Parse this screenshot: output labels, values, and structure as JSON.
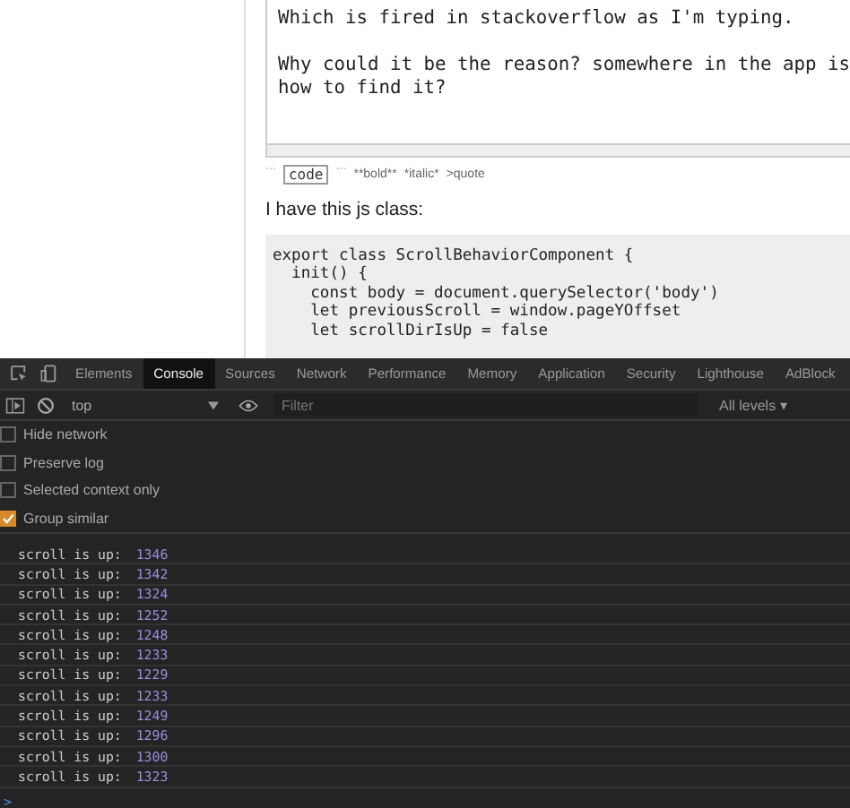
{
  "editor": {
    "paragraphs": [
      [
        "Which is fired in stackoverflow as I'm typing."
      ],
      [
        "Why could it be the reason? somewhere in the app is",
        "how to find it?"
      ]
    ]
  },
  "format_hints": [
    {
      "kind": "ticks",
      "text": "```"
    },
    {
      "kind": "boxed",
      "text": "code"
    },
    {
      "kind": "ticks",
      "text": "```"
    },
    {
      "kind": "plain",
      "text": "**bold**"
    },
    {
      "kind": "plain",
      "text": "*italic*"
    },
    {
      "kind": "plain",
      "text": ">quote"
    }
  ],
  "paragraph": "I have this js class:",
  "code_lines": [
    "export class ScrollBehaviorComponent {",
    "  init() {",
    "    const body = document.querySelector('body')",
    "    let previousScroll = window.pageYOffset",
    "    let scrollDirIsUp = false"
  ],
  "devtools": {
    "tabs": [
      {
        "label": "Elements",
        "selected": false
      },
      {
        "label": "Console",
        "selected": true
      },
      {
        "label": "Sources",
        "selected": false
      },
      {
        "label": "Network",
        "selected": false
      },
      {
        "label": "Performance",
        "selected": false
      },
      {
        "label": "Memory",
        "selected": false
      },
      {
        "label": "Application",
        "selected": false
      },
      {
        "label": "Security",
        "selected": false
      },
      {
        "label": "Lighthouse",
        "selected": false
      },
      {
        "label": "AdBlock",
        "selected": false
      }
    ],
    "context": "top",
    "filter_placeholder": "Filter",
    "levels": "All levels ▾",
    "options": [
      {
        "label": "Hide network",
        "checked": false
      },
      {
        "label": "Preserve log",
        "checked": false
      },
      {
        "label": "Selected context only",
        "checked": false
      },
      {
        "label": "Group similar",
        "checked": true
      }
    ],
    "log": [
      {
        "message": "scroll is up:",
        "value": "1346"
      },
      {
        "message": "scroll is up:",
        "value": "1342"
      },
      {
        "message": "scroll is up:",
        "value": "1324"
      },
      {
        "message": "scroll is up:",
        "value": "1252"
      },
      {
        "message": "scroll is up:",
        "value": "1248"
      },
      {
        "message": "scroll is up:",
        "value": "1233"
      },
      {
        "message": "scroll is up:",
        "value": "1229"
      },
      {
        "message": "scroll is up:",
        "value": "1233"
      },
      {
        "message": "scroll is up:",
        "value": "1249"
      },
      {
        "message": "scroll is up:",
        "value": "1296"
      },
      {
        "message": "scroll is up:",
        "value": "1300"
      },
      {
        "message": "scroll is up:",
        "value": "1323"
      }
    ],
    "prompt": ">"
  }
}
